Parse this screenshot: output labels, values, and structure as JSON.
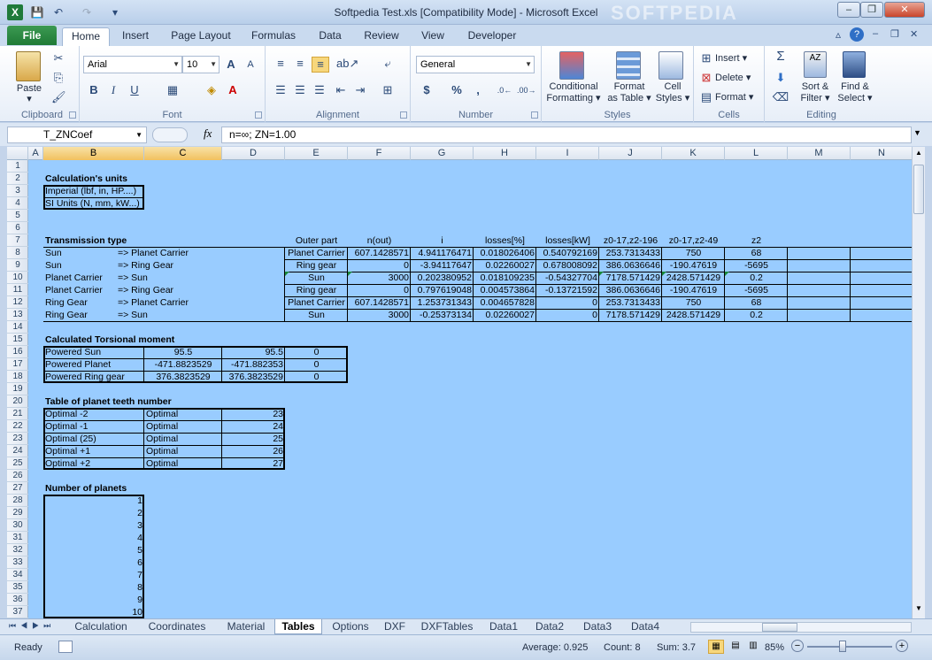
{
  "window": {
    "title": "Softpedia Test.xls  [Compatibility Mode]  -  Microsoft Excel",
    "watermark": "SOFTPEDIA"
  },
  "quick_access": [
    "save-icon",
    "undo-icon",
    "redo-icon",
    "customize-icon"
  ],
  "ribbon_tabs": [
    "File",
    "Home",
    "Insert",
    "Page Layout",
    "Formulas",
    "Data",
    "Review",
    "View",
    "Developer"
  ],
  "ribbon": {
    "clipboard": {
      "paste": "Paste",
      "group": "Clipboard"
    },
    "font": {
      "name": "Arial",
      "size": "10",
      "bold": "B",
      "italic": "I",
      "underline": "U",
      "group": "Font"
    },
    "alignment": {
      "group": "Alignment"
    },
    "number": {
      "format": "General",
      "currency": "$",
      "percent": "%",
      "comma": ",",
      "group": "Number"
    },
    "styles": {
      "conditional": "Conditional",
      "conditional2": "Formatting",
      "table": "Format",
      "table2": "as Table",
      "cell": "Cell",
      "cell2": "Styles",
      "group": "Styles"
    },
    "cells": {
      "insert": "Insert",
      "delete": "Delete",
      "format": "Format",
      "group": "Cells"
    },
    "editing": {
      "sigma": "Σ",
      "sort": "Sort &",
      "sort2": "Filter",
      "find": "Find &",
      "find2": "Select",
      "group": "Editing"
    }
  },
  "formula_bar": {
    "name_box": "T_ZNCoef",
    "fx": "fx",
    "formula": "n=∞; ZN=1.00"
  },
  "columns": [
    "A",
    "B",
    "C",
    "D",
    "E",
    "F",
    "G",
    "H",
    "I",
    "J",
    "K",
    "L",
    "M",
    "N"
  ],
  "rows": [
    "1",
    "2",
    "3",
    "4",
    "5",
    "6",
    "7",
    "8",
    "9",
    "10",
    "11",
    "12",
    "13",
    "14",
    "15",
    "16",
    "17",
    "18",
    "19",
    "20",
    "21",
    "22",
    "23",
    "24",
    "25",
    "26",
    "27",
    "28",
    "29",
    "30",
    "31",
    "32",
    "33",
    "34",
    "35",
    "36",
    "37"
  ],
  "sheet": {
    "units_title": "Calculation's units",
    "units": [
      "Imperial (lbf, in, HP....)",
      "SI Units (N, mm, kW...)"
    ],
    "trans_title": "Transmission type",
    "trans_headers": [
      "Outer part",
      "n(out)",
      "i",
      "losses[%]",
      "losses[kW]",
      "z0-17,z2-196",
      "z0-17,z2-49",
      "z2"
    ],
    "trans_rows": [
      {
        "from": "Sun",
        "to": "=> Planet Carrier",
        "outer": "Planet Carrier",
        "n": "607.1428571",
        "i": "4.941176471",
        "lp": "0.018026406",
        "lk": "0.540792169",
        "z1": "253.7313433",
        "z2": "750",
        "z3": "68"
      },
      {
        "from": "Sun",
        "to": "=> Ring Gear",
        "outer": "Ring gear",
        "n": "0",
        "i": "-3.94117647",
        "lp": "0.02260027",
        "lk": "0.678008092",
        "z1": "386.0636646",
        "z2": "-190.47619",
        "z3": "-5695"
      },
      {
        "from": "Planet Carrier",
        "to": "=> Sun",
        "outer": "Sun",
        "n": "3000",
        "i": "0.202380952",
        "lp": "0.018109235",
        "lk": "-0.54327704",
        "z1": "7178.571429",
        "z2": "2428.571429",
        "z3": "0.2"
      },
      {
        "from": "Planet Carrier",
        "to": "=> Ring Gear",
        "outer": "Ring gear",
        "n": "0",
        "i": "0.797619048",
        "lp": "0.004573864",
        "lk": "-0.13721592",
        "z1": "386.0636646",
        "z2": "-190.47619",
        "z3": "-5695"
      },
      {
        "from": "Ring Gear",
        "to": "=> Planet Carrier",
        "outer": "Planet Carrier",
        "n": "607.1428571",
        "i": "1.253731343",
        "lp": "0.004657828",
        "lk": "0",
        "z1": "253.7313433",
        "z2": "750",
        "z3": "68"
      },
      {
        "from": "Ring Gear",
        "to": "=> Sun",
        "outer": "Sun",
        "n": "3000",
        "i": "-0.25373134",
        "lp": "0.02260027",
        "lk": "0",
        "z1": "7178.571429",
        "z2": "2428.571429",
        "z3": "0.2"
      }
    ],
    "torsion_title": "Calculated Torsional moment",
    "torsion_rows": [
      {
        "label": "Powered Sun",
        "c": "95.5",
        "d": "95.5",
        "e": "0"
      },
      {
        "label": "Powered Planet",
        "c": "-471.8823529",
        "d": "-471.882353",
        "e": "0"
      },
      {
        "label": "Powered Ring gear",
        "c": "376.3823529",
        "d": "376.3823529",
        "e": "0"
      }
    ],
    "teeth_title": "Table of planet teeth number",
    "teeth_rows": [
      {
        "label": "Optimal -2",
        "c": "Optimal",
        "d": "23"
      },
      {
        "label": "Optimal -1",
        "c": "Optimal",
        "d": "24"
      },
      {
        "label": "Optimal (25)",
        "c": "Optimal",
        "d": "25"
      },
      {
        "label": "Optimal +1",
        "c": "Optimal",
        "d": "26"
      },
      {
        "label": "Optimal +2",
        "c": "Optimal",
        "d": "27"
      }
    ],
    "planets_title": "Number of planets",
    "planets": [
      "1",
      "2",
      "3",
      "4",
      "5",
      "6",
      "7",
      "8",
      "9",
      "10"
    ]
  },
  "sheet_tabs": [
    "Calculation",
    "Coordinates",
    "Material",
    "Tables",
    "Options",
    "DXF",
    "DXFTables",
    "Data1",
    "Data2",
    "Data3",
    "Data4"
  ],
  "active_sheet": "Tables",
  "status": {
    "ready": "Ready",
    "average": "Average: 0.925",
    "count": "Count: 8",
    "sum": "Sum: 3.7",
    "zoom": "85%"
  }
}
